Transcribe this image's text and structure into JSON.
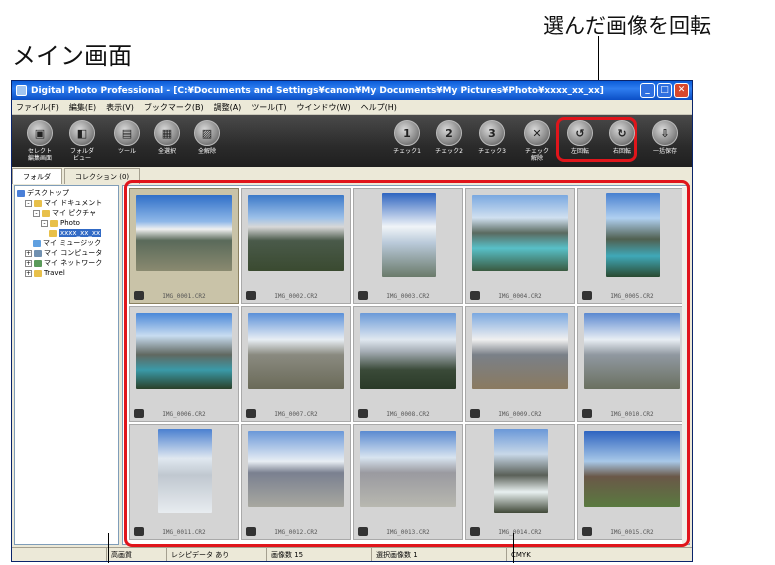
{
  "annotations": {
    "top_right_label": "選んだ画像を回転",
    "screen_title": "メイン画面"
  },
  "window": {
    "title": "Digital Photo Professional - [C:¥Documents and Settings¥canon¥My Documents¥My Pictures¥Photo¥xxxx_xx_xx]",
    "minimize": "_",
    "maximize": "□",
    "close": "✕"
  },
  "menu": [
    "ファイル(F)",
    "編集(E)",
    "表示(V)",
    "ブックマーク(B)",
    "調整(A)",
    "ツール(T)",
    "ウインドウ(W)",
    "ヘルプ(H)"
  ],
  "toolbar": {
    "left": [
      {
        "label": "セレクト\n編集画面",
        "icon": "select-edit-icon"
      },
      {
        "label": "フォルダ\nビュー",
        "icon": "folder-view-icon"
      },
      {
        "label": "ツール",
        "icon": "tool-icon"
      },
      {
        "label": "全選択",
        "icon": "select-all-icon"
      },
      {
        "label": "全解除",
        "icon": "deselect-all-icon"
      }
    ],
    "right": [
      {
        "label": "チェック1",
        "icon": "check1-icon"
      },
      {
        "label": "チェック2",
        "icon": "check2-icon"
      },
      {
        "label": "チェック3",
        "icon": "check3-icon"
      },
      {
        "label": "チェック\n解除",
        "icon": "check-clear-icon"
      },
      {
        "label": "左回転",
        "icon": "rotate-left-icon"
      },
      {
        "label": "右回転",
        "icon": "rotate-right-icon"
      },
      {
        "label": "一括保存",
        "icon": "batch-save-icon"
      }
    ]
  },
  "tabs": [
    "フォルダ",
    "コレクション (0)"
  ],
  "tree": [
    {
      "label": "デスクトップ",
      "indent": 0,
      "icon": "desktop",
      "pm": ""
    },
    {
      "label": "マイ ドキュメント",
      "indent": 1,
      "icon": "folder",
      "pm": "-"
    },
    {
      "label": "マイ ピクチャ",
      "indent": 2,
      "icon": "folder",
      "pm": "-"
    },
    {
      "label": "Photo",
      "indent": 3,
      "icon": "folder",
      "pm": "-"
    },
    {
      "label": "xxxx_xx_xx",
      "indent": 4,
      "icon": "folder",
      "pm": "",
      "selected": true
    },
    {
      "label": "マイ ミュージック",
      "indent": 2,
      "icon": "music",
      "pm": ""
    },
    {
      "label": "マイ コンピュータ",
      "indent": 1,
      "icon": "pc",
      "pm": "+"
    },
    {
      "label": "マイ ネットワーク",
      "indent": 1,
      "icon": "net",
      "pm": "+"
    },
    {
      "label": "Travel",
      "indent": 1,
      "icon": "folder",
      "pm": "+"
    }
  ],
  "thumbnails": [
    {
      "name": "IMG_0001.CR2",
      "selected": true
    },
    {
      "name": "IMG_0002.CR2"
    },
    {
      "name": "IMG_0003.CR2"
    },
    {
      "name": "IMG_0004.CR2"
    },
    {
      "name": "IMG_0005.CR2"
    },
    {
      "name": "IMG_0006.CR2"
    },
    {
      "name": "IMG_0007.CR2"
    },
    {
      "name": "IMG_0008.CR2"
    },
    {
      "name": "IMG_0009.CR2"
    },
    {
      "name": "IMG_0010.CR2"
    },
    {
      "name": "IMG_0011.CR2"
    },
    {
      "name": "IMG_0012.CR2"
    },
    {
      "name": "IMG_0013.CR2"
    },
    {
      "name": "IMG_0014.CR2"
    },
    {
      "name": "IMG_0015.CR2"
    }
  ],
  "status": {
    "quality": "高画質",
    "recipe": "レシピデータ あり",
    "count": "画像数 15",
    "selected": "選択画像数 1",
    "colorspace": "CMYK"
  },
  "colors": {
    "highlight": "#e0151b",
    "titlebar": "#0a5bd8"
  }
}
